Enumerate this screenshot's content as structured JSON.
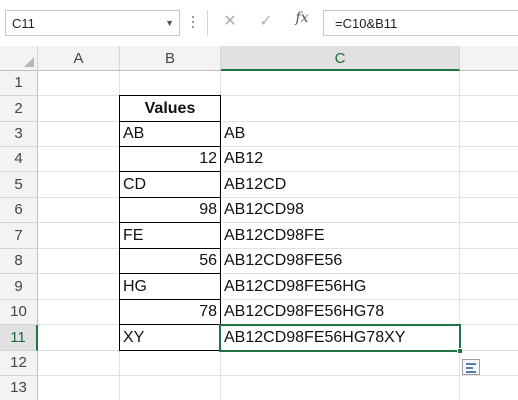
{
  "formula_bar": {
    "name_box": "C11",
    "name_box_arrow": "▼",
    "cancel_icon": "✕",
    "enter_icon": "✓",
    "fx_label": "fx",
    "formula": "=C10&B11"
  },
  "columns": [
    "A",
    "B",
    "C"
  ],
  "rows": [
    "1",
    "2",
    "3",
    "4",
    "5",
    "6",
    "7",
    "8",
    "9",
    "10",
    "11",
    "12",
    "13"
  ],
  "active_cell": "C11",
  "cells": {
    "B2": "Values",
    "B3": "AB",
    "B4": "12",
    "B5": "CD",
    "B6": "98",
    "B7": "FE",
    "B8": "56",
    "B9": "HG",
    "B10": "78",
    "B11": "XY",
    "C3": "AB",
    "C4": "AB12",
    "C5": "AB12CD",
    "C6": "AB12CD98",
    "C7": "AB12CD98FE",
    "C8": "AB12CD98FE56",
    "C9": "AB12CD98FE56HG",
    "C10": "AB12CD98FE56HG78",
    "C11": "AB12CD98FE56HG78XY"
  },
  "colors": {
    "selection_accent": "#217346",
    "header_bg": "#f3f3f3",
    "gridline": "#e1e1e1"
  },
  "icons": {
    "quick_analysis": "quick-analysis-icon"
  }
}
